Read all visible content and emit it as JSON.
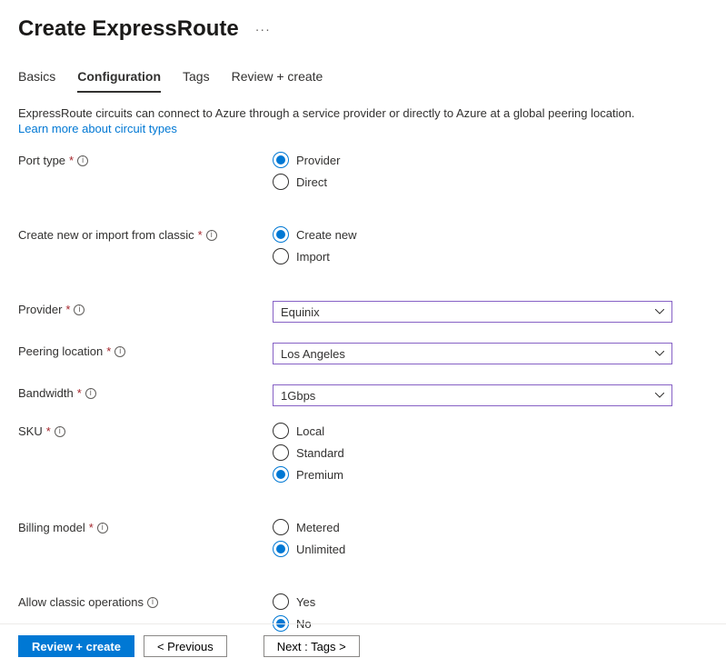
{
  "header": {
    "title": "Create ExpressRoute",
    "more": "···"
  },
  "tabs": {
    "basics": "Basics",
    "configuration": "Configuration",
    "tags": "Tags",
    "review": "Review + create"
  },
  "description": {
    "text": "ExpressRoute circuits can connect to Azure through a service provider or directly to Azure at a global peering location.",
    "link": "Learn more about circuit types"
  },
  "fields": {
    "portType": {
      "label": "Port type",
      "options": {
        "provider": "Provider",
        "direct": "Direct"
      },
      "selected": "provider"
    },
    "createImport": {
      "label": "Create new or import from classic",
      "options": {
        "create": "Create new",
        "import": "Import"
      },
      "selected": "create"
    },
    "provider": {
      "label": "Provider",
      "value": "Equinix"
    },
    "peeringLocation": {
      "label": "Peering location",
      "value": "Los Angeles"
    },
    "bandwidth": {
      "label": "Bandwidth",
      "value": "1Gbps"
    },
    "sku": {
      "label": "SKU",
      "options": {
        "local": "Local",
        "standard": "Standard",
        "premium": "Premium"
      },
      "selected": "premium"
    },
    "billingModel": {
      "label": "Billing model",
      "options": {
        "metered": "Metered",
        "unlimited": "Unlimited"
      },
      "selected": "unlimited"
    },
    "allowClassic": {
      "label": "Allow classic operations",
      "options": {
        "yes": "Yes",
        "no": "No"
      },
      "selected": "no"
    }
  },
  "footer": {
    "review": "Review + create",
    "previous": "< Previous",
    "next": "Next : Tags >"
  }
}
